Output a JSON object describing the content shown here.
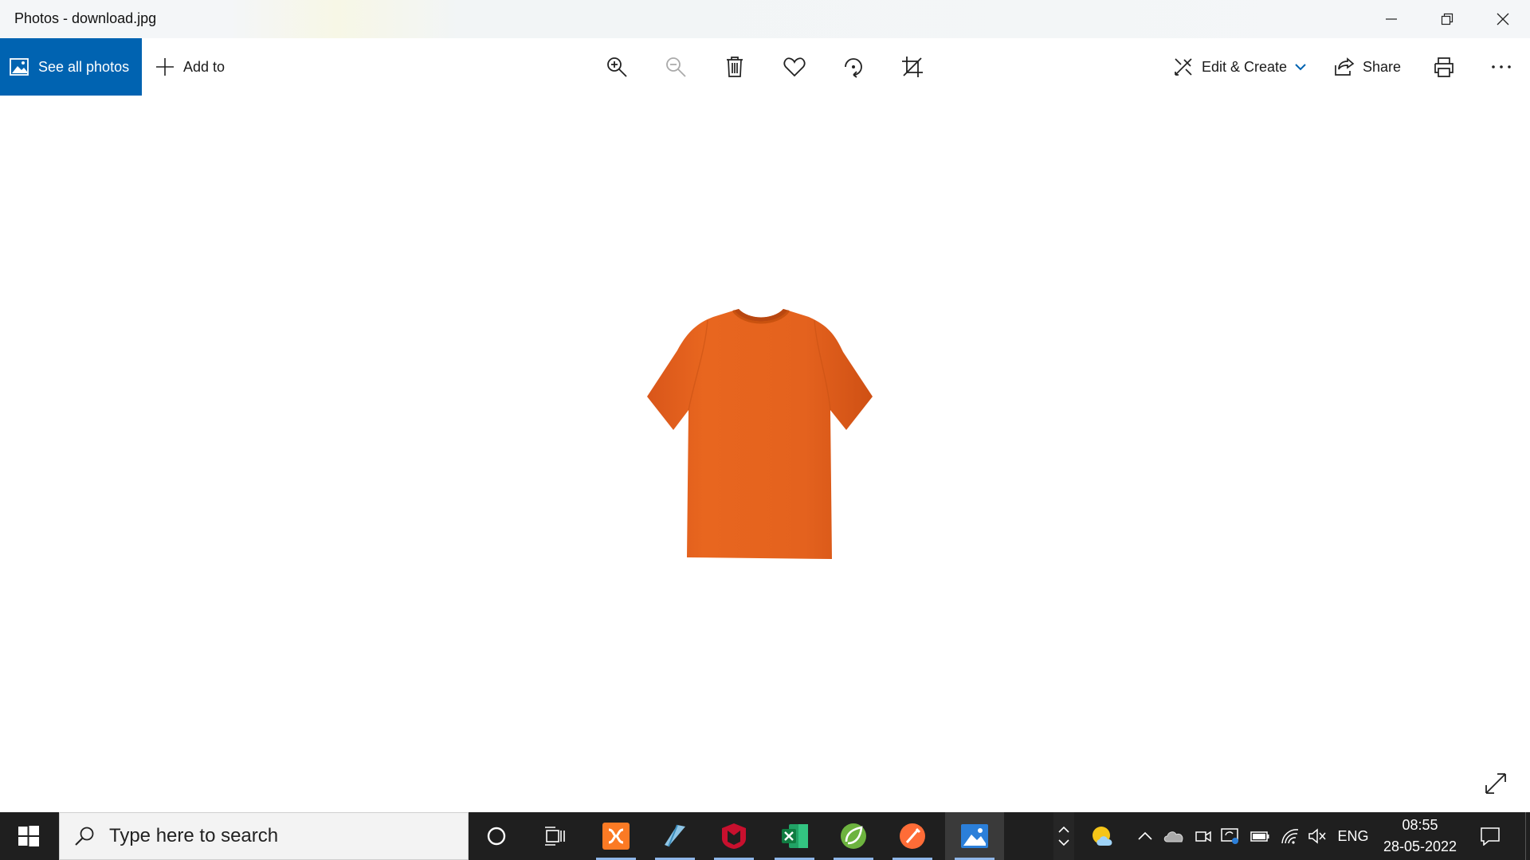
{
  "window": {
    "title": "Photos - download.jpg"
  },
  "toolbar": {
    "see_all_photos": "See all photos",
    "add_to": "Add to",
    "edit_create": "Edit & Create",
    "share": "Share"
  },
  "icons": [
    "photos-icon",
    "plus-icon",
    "zoom-in-icon",
    "zoom-out-icon",
    "delete-icon",
    "heart-icon",
    "rotate-icon",
    "crop-icon",
    "edit-create-icon",
    "chevron-down-icon",
    "share-icon",
    "print-icon",
    "more-icon",
    "expand-icon"
  ],
  "image": {
    "subject": "orange t-shirt",
    "color": "#e4621e"
  },
  "taskbar": {
    "search_placeholder": "Type here to search",
    "apps": [
      "cortana",
      "task-view",
      "xampp",
      "notepad",
      "mcafee",
      "excel",
      "spring",
      "postman",
      "photos"
    ],
    "language": "ENG",
    "time": "08:55",
    "date": "28-05-2022"
  },
  "colors": {
    "accent": "#0063b1",
    "taskbar": "#1f1f1f",
    "shirt": "#e4621e"
  }
}
